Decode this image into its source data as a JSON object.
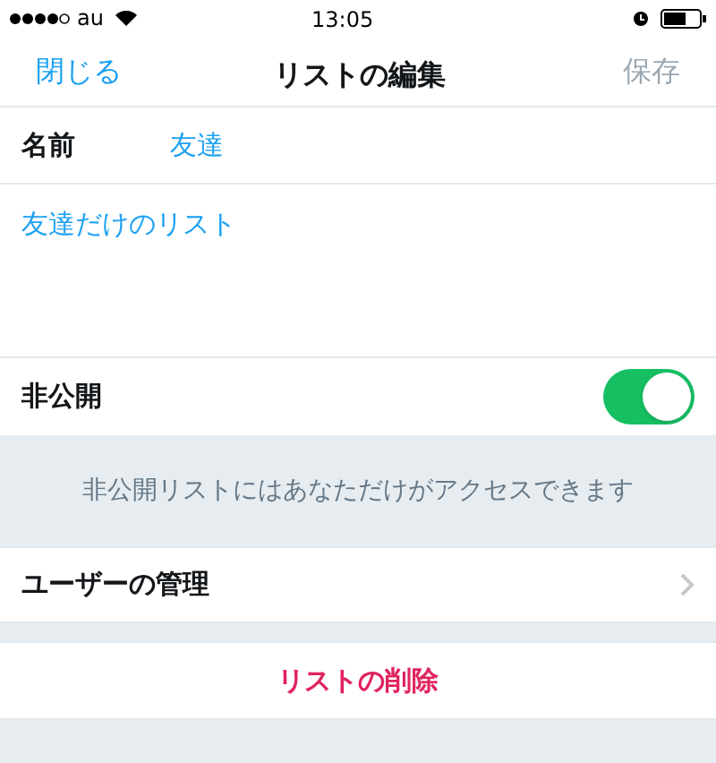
{
  "status_bar": {
    "carrier": "au",
    "time": "13:05"
  },
  "nav": {
    "close": "閉じる",
    "title": "リストの編集",
    "save": "保存",
    "save_disabled": true
  },
  "name_row": {
    "label": "名前",
    "value": "友達"
  },
  "description": {
    "value": "友達だけのリスト"
  },
  "private_row": {
    "label": "非公開",
    "on": true
  },
  "private_note": "非公開リストにはあなただけがアクセスできます",
  "manage_row": {
    "label": "ユーザーの管理"
  },
  "delete_button": "リストの削除"
}
